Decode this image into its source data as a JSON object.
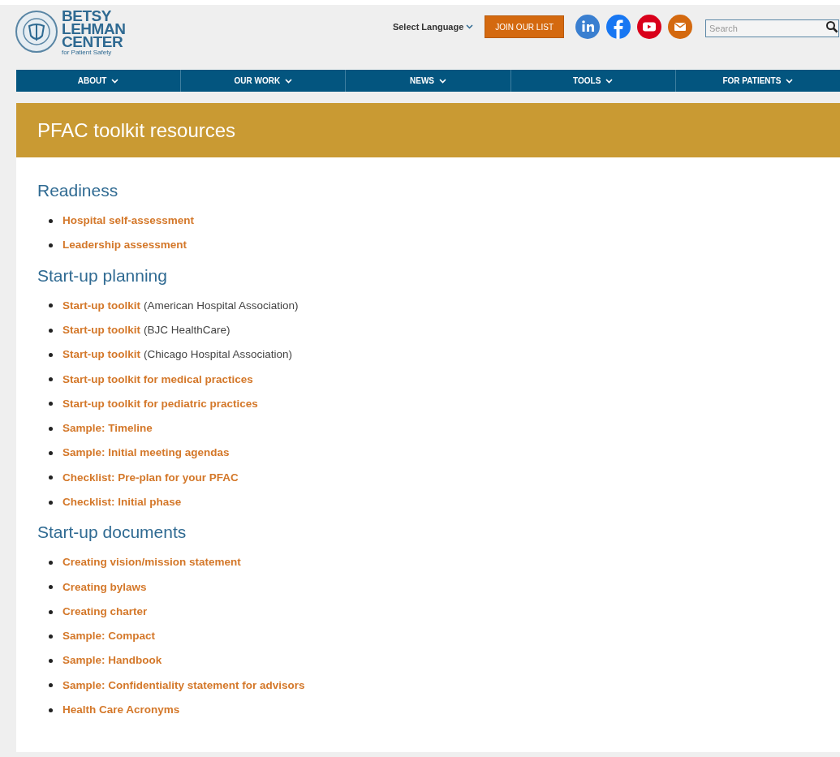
{
  "logo": {
    "lines": [
      "BETSY",
      "LEHMAN",
      "CENTER"
    ],
    "tagline": "for Patient Safety"
  },
  "header": {
    "language": "Select Language",
    "join_button": "JOIN OUR LIST",
    "search": {
      "placeholder": "Search"
    }
  },
  "nav": [
    {
      "label": "ABOUT"
    },
    {
      "label": "OUR WORK"
    },
    {
      "label": "NEWS"
    },
    {
      "label": "TOOLS"
    },
    {
      "label": "FOR PATIENTS"
    }
  ],
  "banner": {
    "title": "PFAC toolkit resources"
  },
  "sections": [
    {
      "heading": "Readiness",
      "items": [
        {
          "link": "Hospital self-assessment"
        },
        {
          "link": "Leadership assessment"
        }
      ]
    },
    {
      "heading": "Start-up planning",
      "items": [
        {
          "link": "Start-up toolkit",
          "note": "(American Hospital Association)"
        },
        {
          "link": "Start-up toolkit",
          "note": "(BJC HealthCare)"
        },
        {
          "link": "Start-up toolkit",
          "note": "(Chicago Hospital Association)"
        },
        {
          "link": "Start-up toolkit for medical practices"
        },
        {
          "link": "Start-up toolkit for pediatric practices"
        },
        {
          "link": "Sample: Timeline"
        },
        {
          "link": "Sample: Initial meeting agendas"
        },
        {
          "link": "Checklist: Pre-plan for your PFAC"
        },
        {
          "link": "Checklist: Initial phase"
        }
      ]
    },
    {
      "heading": "Start-up documents",
      "items": [
        {
          "link": "Creating vision/mission statement"
        },
        {
          "link": "Creating bylaws"
        },
        {
          "link": "Creating charter"
        },
        {
          "link": "Sample: Compact"
        },
        {
          "link": "Sample: Handbook"
        },
        {
          "link": "Sample: Confidentiality statement for advisors"
        },
        {
          "link": "Health Care Acronyms"
        }
      ]
    }
  ]
}
